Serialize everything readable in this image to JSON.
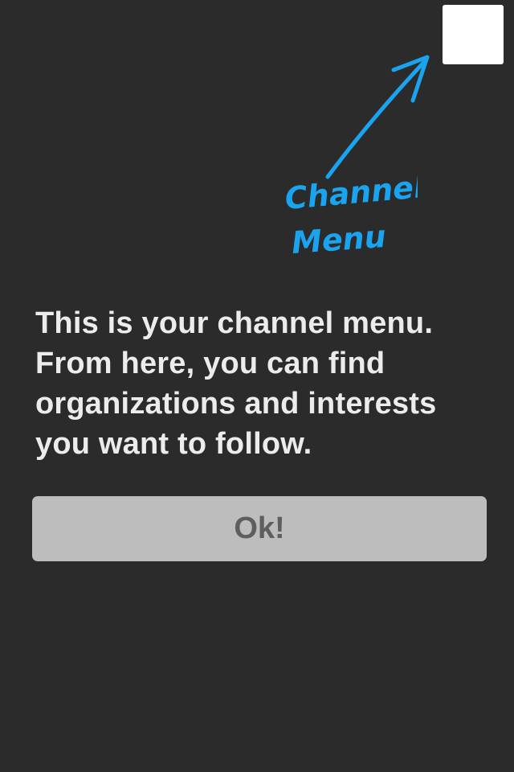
{
  "menu": {
    "icon": "channel-menu-square"
  },
  "hint": {
    "annotation_line1": "Channel",
    "annotation_line2": "Menu",
    "arrow_color": "#1aa3ee"
  },
  "tooltip": {
    "message": "This is your channel menu. From here, you can find organizations and interests you want to follow."
  },
  "actions": {
    "ok_label": "Ok!"
  },
  "colors": {
    "background": "#2b2b2b",
    "text": "#ececec",
    "button_bg": "#bdbdbd",
    "button_text": "#5e5e5e"
  }
}
